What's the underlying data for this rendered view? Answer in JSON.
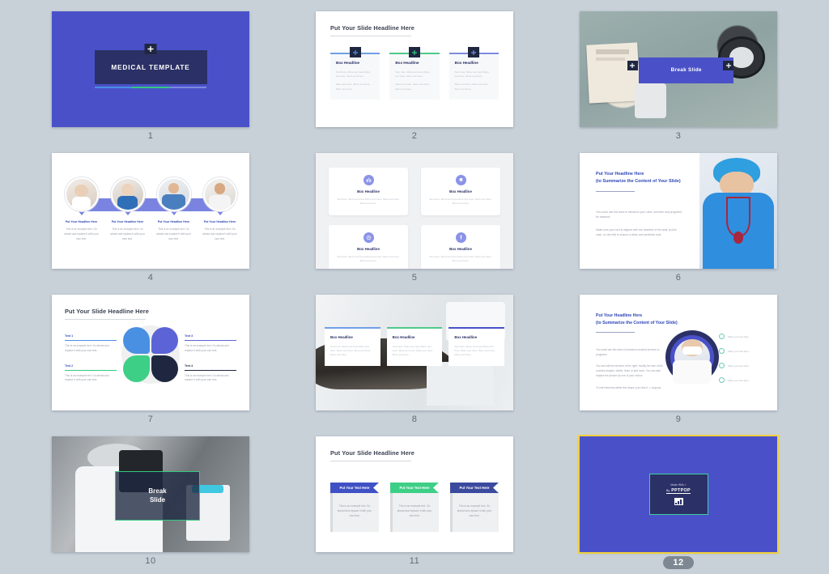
{
  "page": {
    "background_color": "#c8d0d8",
    "selected_slide": 12,
    "total_slides": 12
  },
  "palette": {
    "brand_blue": "#4a51c8",
    "deep_navy": "#2b3166",
    "accent_green": "#34c87f",
    "accent_light_blue": "#4a90e2",
    "accent_purple": "#5b63d6",
    "selection_yellow": "#f2d13b",
    "body_text_gray": "#9aa0ab"
  },
  "common": {
    "slide_headline": "Put Your Slide Headline Here",
    "box_headline": "Box Headline",
    "box_body": "Text here. More text here.More text here. More text here.",
    "box_body2": "More text here. More text here. More text here.",
    "example_text": "This is an example text. Go ahead and replace it with your own text.",
    "headline_here": "Put Your Headline Here",
    "summarize_line": "(to Summarize the Content of Your Slide)"
  },
  "slides": [
    {
      "number": "1",
      "name": "title-slide",
      "title": "MEDICAL TEMPLATE",
      "icon": "medical-cross-icon",
      "bar_colors": [
        "#4a90e2",
        "#34c87f",
        "#7d8ae0"
      ]
    },
    {
      "number": "2",
      "name": "three-column-boxes-slide",
      "headline": "Put Your Slide Headline Here",
      "columns": [
        {
          "line_color": "#6f9fe8",
          "headline": "Box Headline",
          "body": "Text here. More text here.More text here. More text here.",
          "body2": "More text here. More text here. More text here."
        },
        {
          "line_color": "#4fc98a",
          "headline": "Box Headline",
          "body": "Text here. More text here.More text here. More text here.",
          "body2": "More text here. More text here. More text here."
        },
        {
          "line_color": "#7d8ae0",
          "headline": "Box Headline",
          "body": "Text here. More text here.More text here. More text here.",
          "body2": "More text here. More text here. More text here."
        }
      ]
    },
    {
      "number": "3",
      "name": "break-slide-blood-pressure",
      "banner_text": "Break Slide",
      "photo_alt": "blood pressure measurement on table with stethoscope and clipboard"
    },
    {
      "number": "4",
      "name": "team-circles-slide",
      "people": [
        {
          "headline": "Put Your Headline Here",
          "body": "This is an example text. Go ahead and replace it with your own text."
        },
        {
          "headline": "Put Your Headline Here",
          "body": "This is an example text. Go ahead and replace it with your own text."
        },
        {
          "headline": "Put Your Headline Here",
          "body": "This is an example text. Go ahead and replace it with your own text."
        },
        {
          "headline": "Put Your Headline Here",
          "body": "This is an example text. Go ahead and replace it with your own text."
        }
      ]
    },
    {
      "number": "5",
      "name": "four-icon-cards-slide",
      "cards": [
        {
          "icon": "lungs-icon",
          "headline": "Box Headline",
          "body": "Text here. More text here.More text here. More text here. More text here."
        },
        {
          "icon": "tooth-icon",
          "headline": "Box Headline",
          "body": "Text here. More text here.More text here. More text here. More text here."
        },
        {
          "icon": "stethoscope-icon",
          "headline": "Box Headline",
          "body": "Text here. More text here.More text here. More text here. More text here."
        },
        {
          "icon": "syringe-icon",
          "headline": "Box Headline",
          "body": "Text here. More text here.More text here. More text here. More text here."
        }
      ]
    },
    {
      "number": "6",
      "name": "headline-with-photo-slide",
      "headline_line1": "Put Your Headline Here",
      "headline_line2": "(to Summarize the Content of Your Slide)",
      "paragraph1": "You could use this area to introduce your clinic, services and programs for instance.",
      "paragraph2": "Make sure your text is aligned with the headline of the slide (in this case, on the left) to ensure a clean and aesthetic look.",
      "photo_alt": "nurse in blue scrubs holding stethoscope"
    },
    {
      "number": "7",
      "name": "petal-diagram-slide",
      "headline": "Put Your Slide Headline Here",
      "items": [
        {
          "label": "Text 1",
          "color": "#4a90e2",
          "body": "This is an example text. Go ahead and replace it with your own text."
        },
        {
          "label": "Text 2",
          "color": "#34c87f",
          "body": "This is an example text. Go ahead and replace it with your own text."
        },
        {
          "label": "Text 3",
          "color": "#5b63d6",
          "body": "This is an example text. Go ahead and replace it with your own text."
        },
        {
          "label": "Text 4",
          "color": "#1f2740",
          "body": "This is an example text. Go ahead and replace it with your own text."
        }
      ]
    },
    {
      "number": "8",
      "name": "photo-background-boxes-slide",
      "photo_alt": "dental treatment chair in clinic",
      "cards": [
        {
          "top_color": "#6f9fe8",
          "headline": "Box Headline",
          "body": "Text here. More text here.More text here. More text here. More text here. More text here."
        },
        {
          "top_color": "#4fc98a",
          "headline": "Box Headline",
          "body": "Text here. More text here.More text here. More text here. More text here. More text here."
        },
        {
          "top_color": "#4a51c8",
          "headline": "Box Headline",
          "body": "Text here. More text here.More text here. More text here. More text here. More text here."
        }
      ]
    },
    {
      "number": "9",
      "name": "circle-photo-callouts-slide",
      "headline_line1": "Put Your Headline Here",
      "headline_line2": "(to Summarize the Content of Your Slide)",
      "paragraph1": "You could use this area to introduce medical services or programs.",
      "paragraph2": "You can edit the element of the right: modify the size of the rounded shapes, delete, them or add more. You can also replace the picture by one of your choice.",
      "paragraph3": "To edit elements within this shape, just click it -> ungroup",
      "callouts": [
        "Place your text here",
        "Place your text here",
        "Place your text here",
        "Place your text here"
      ],
      "photo_alt": "doctor wearing face mask"
    },
    {
      "number": "10",
      "name": "break-slide-laboratory",
      "banner_line1": "Break",
      "banner_line2": "Slide",
      "border_color": "#34c87f",
      "photo_alt": "scientist looking into microscope in laboratory"
    },
    {
      "number": "11",
      "name": "ribbon-banners-slide",
      "headline": "Put Your Slide Headline Here",
      "columns": [
        {
          "ribbon_color": "#3f51c4",
          "ribbon_text": "Put Your Text Here",
          "body": "This is an example text. Go ahead and replace it with your own text."
        },
        {
          "ribbon_color": "#3ecf87",
          "ribbon_text": "Put Your Text Here",
          "body": "This is an example text. Go ahead and replace it with your own text."
        },
        {
          "ribbon_color": "#3b4a9e",
          "ribbon_text": "Put Your Text Here",
          "body": "This is an example text. Go ahead and replace it with your own text."
        }
      ]
    },
    {
      "number": "12",
      "name": "credits-slide",
      "made_with": "Made With",
      "heart": "♥",
      "by": "By",
      "brand": "PPTPOP",
      "icon": "chart-icon",
      "selected": true
    }
  ]
}
